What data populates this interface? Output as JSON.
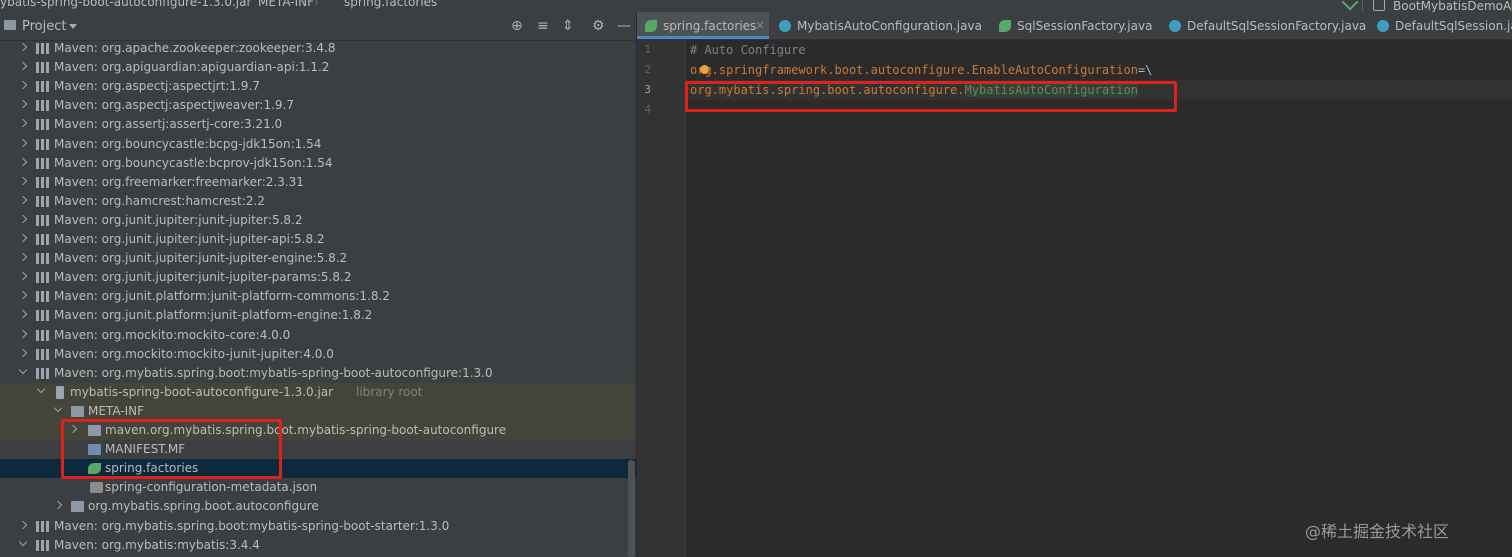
{
  "breadcrumb": {
    "jar": "ybatis-spring-boot-autoconfigure-1.3.0.jar",
    "folder": "META-INF",
    "file": "spring.factories"
  },
  "run_config": {
    "label": "BootMybatisDemoAp"
  },
  "project_panel": {
    "title": "Project",
    "rows": [
      {
        "label": "Maven: org.apache.zookeeper:zookeeper:3.4.8",
        "extra": ""
      },
      {
        "label": "Maven: org.apiguardian:apiguardian-api:1.1.2",
        "extra": ""
      },
      {
        "label": "Maven: org.aspectj:aspectjrt:1.9.7",
        "extra": ""
      },
      {
        "label": "Maven: org.aspectj:aspectjweaver:1.9.7",
        "extra": ""
      },
      {
        "label": "Maven: org.assertj:assertj-core:3.21.0",
        "extra": ""
      },
      {
        "label": "Maven: org.bouncycastle:bcpg-jdk15on:1.54",
        "extra": ""
      },
      {
        "label": "Maven: org.bouncycastle:bcprov-jdk15on:1.54",
        "extra": ""
      },
      {
        "label": "Maven: org.freemarker:freemarker:2.3.31",
        "extra": ""
      },
      {
        "label": "Maven: org.hamcrest:hamcrest:2.2",
        "extra": ""
      },
      {
        "label": "Maven: org.junit.jupiter:junit-jupiter:5.8.2",
        "extra": ""
      },
      {
        "label": "Maven: org.junit.jupiter:junit-jupiter-api:5.8.2",
        "extra": ""
      },
      {
        "label": "Maven: org.junit.jupiter:junit-jupiter-engine:5.8.2",
        "extra": ""
      },
      {
        "label": "Maven: org.junit.jupiter:junit-jupiter-params:5.8.2",
        "extra": ""
      },
      {
        "label": "Maven: org.junit.platform:junit-platform-commons:1.8.2",
        "extra": ""
      },
      {
        "label": "Maven: org.junit.platform:junit-platform-engine:1.8.2",
        "extra": ""
      },
      {
        "label": "Maven: org.mockito:mockito-core:4.0.0",
        "extra": ""
      },
      {
        "label": "Maven: org.mockito:mockito-junit-jupiter:4.0.0",
        "extra": ""
      },
      {
        "label": "Maven: org.mybatis.spring.boot:mybatis-spring-boot-autoconfigure:1.3.0",
        "extra": ""
      },
      {
        "label": "mybatis-spring-boot-autoconfigure-1.3.0.jar",
        "extra": "library root"
      },
      {
        "label": "META-INF",
        "extra": ""
      },
      {
        "label": "maven.org.mybatis.spring.boot.mybatis-spring-boot-autoconfigure",
        "extra": ""
      },
      {
        "label": "MANIFEST.MF",
        "extra": ""
      },
      {
        "label": "spring.factories",
        "extra": ""
      },
      {
        "label": "spring-configuration-metadata.json",
        "extra": ""
      },
      {
        "label": "org.mybatis.spring.boot.autoconfigure",
        "extra": ""
      },
      {
        "label": "Maven: org.mybatis.spring.boot:mybatis-spring-boot-starter:1.3.0",
        "extra": ""
      },
      {
        "label": "Maven: org.mybatis:mybatis:3.4.4",
        "extra": ""
      }
    ]
  },
  "editor": {
    "tabs": [
      {
        "label": "spring.factories",
        "close": "×"
      },
      {
        "label": "MybatisAutoConfiguration.java"
      },
      {
        "label": "SqlSessionFactory.java"
      },
      {
        "label": "DefaultSqlSessionFactory.java"
      },
      {
        "label": "DefaultSqlSession.java"
      }
    ],
    "line_numbers": [
      "1",
      "2",
      "3",
      "4"
    ],
    "code": {
      "line1": "# Auto Configure",
      "line2_key": "org.springframework.boot.autoconfigure.EnableAutoConfiguration",
      "line2_eq": "=\\",
      "line3_pkg": "org.mybatis.spring.boot.autoconfigure.",
      "line3_cls": "MybatisAutoConfiguration"
    }
  },
  "watermark": "@稀土掘金技术社区",
  "colors": {
    "highlight_box": "#e0201b",
    "selection": "#0d293e",
    "tab_underline": "#4a88c7"
  }
}
